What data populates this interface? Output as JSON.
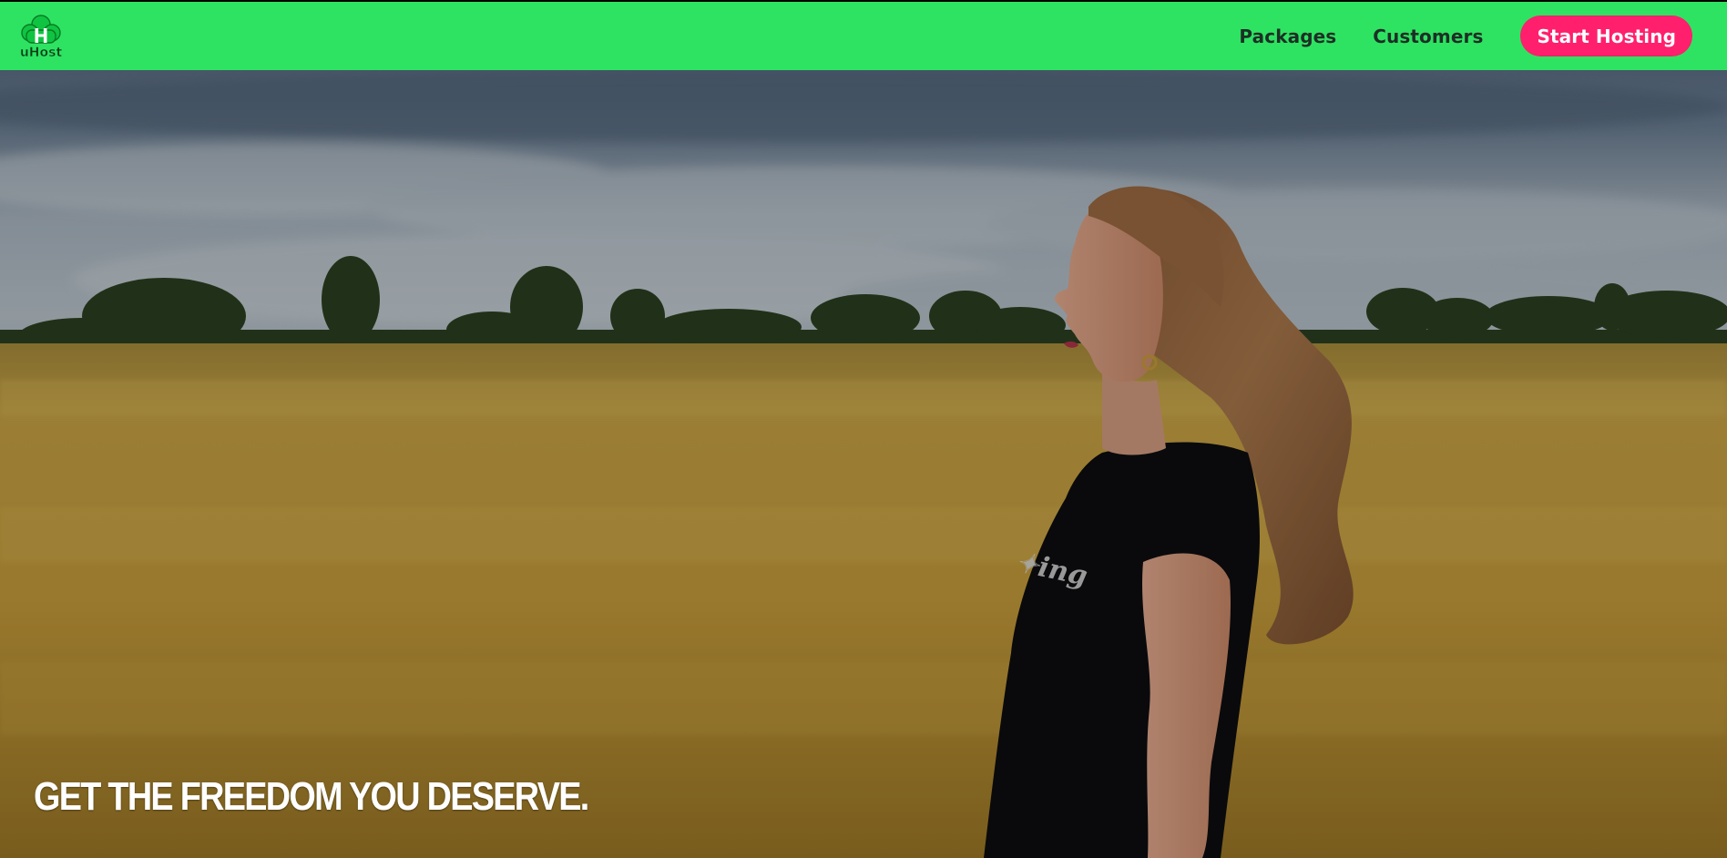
{
  "brand": {
    "logo_text": "uHost",
    "logo_letter": "H",
    "logo_color": "#0a8a2c"
  },
  "nav": {
    "background": "#2ee362",
    "links": [
      {
        "label": "Packages"
      },
      {
        "label": "Customers"
      }
    ],
    "cta_label": "Start Hosting",
    "cta_color": "#ff1f6d"
  },
  "hero": {
    "headline": "GET THE FREEDOM YOU DESERVE.",
    "image_icon": "woman-in-wheat-field-photo"
  }
}
